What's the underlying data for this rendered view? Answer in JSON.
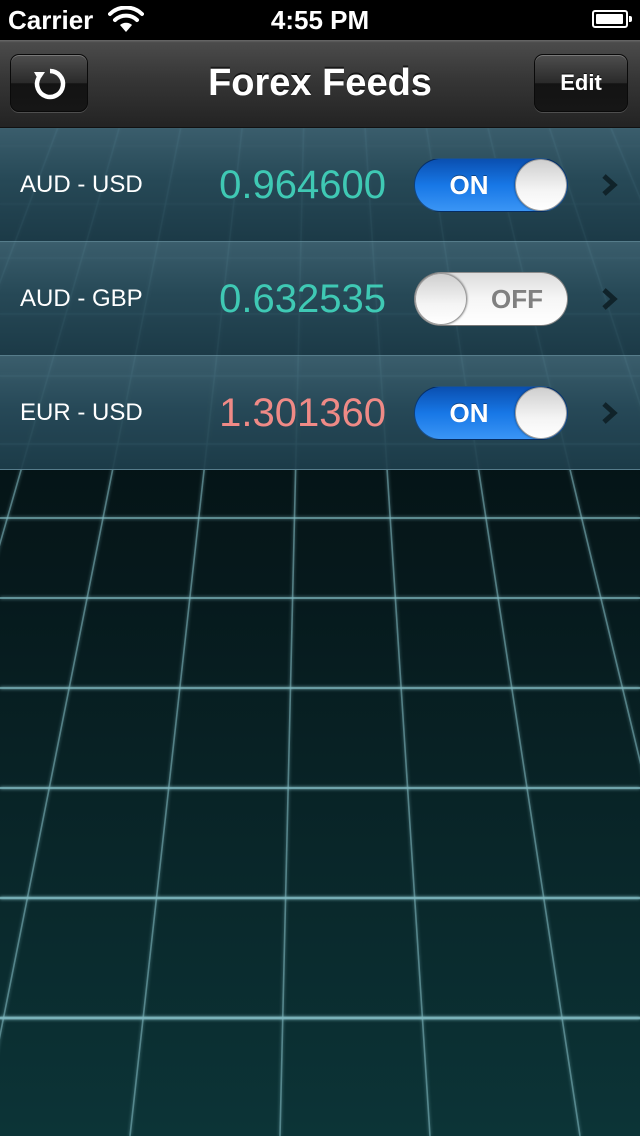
{
  "status_bar": {
    "carrier": "Carrier",
    "time": "4:55 PM",
    "wifi_icon": "wifi-icon",
    "battery_icon": "battery-icon"
  },
  "nav_bar": {
    "title": "Forex Feeds",
    "left_button_icon": "refresh-icon",
    "edit_label": "Edit"
  },
  "colors": {
    "rate_up": "#3fc9b4",
    "rate_down": "#ef8a86",
    "toggle_on": "#1777e6"
  },
  "feeds": [
    {
      "pair": "AUD - USD",
      "rate": "0.964600",
      "toggle_label": "ON",
      "enabled": true,
      "trend": "up"
    },
    {
      "pair": "AUD - GBP",
      "rate": "0.632535",
      "toggle_label": "OFF",
      "enabled": false,
      "trend": "up"
    },
    {
      "pair": "EUR - USD",
      "rate": "1.301360",
      "toggle_label": "ON",
      "enabled": true,
      "trend": "down"
    }
  ]
}
